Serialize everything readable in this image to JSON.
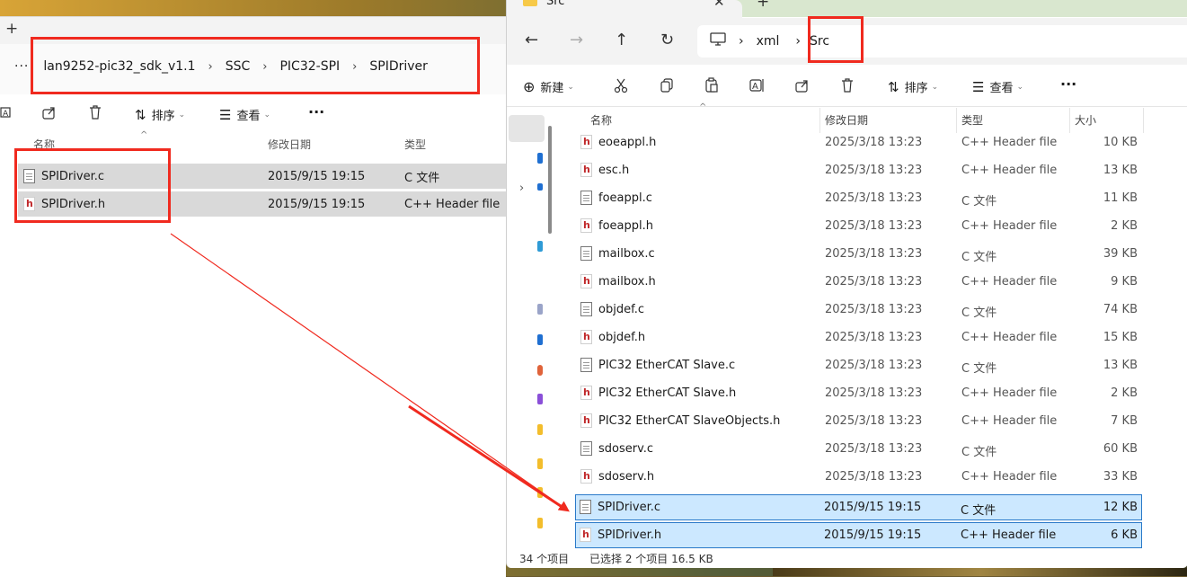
{
  "left_window": {
    "breadcrumb": [
      "lan9252-pic32_sdk_v1.1",
      "SSC",
      "PIC32-SPI",
      "SPIDriver"
    ],
    "more": "···",
    "toolbar": {
      "sort": "排序",
      "view": "查看",
      "more": "···"
    },
    "columns": {
      "name": "名称",
      "date": "修改日期",
      "type": "类型"
    },
    "files": [
      {
        "name": "SPIDriver.c",
        "date": "2015/9/15 19:15",
        "type": "C 文件",
        "icon": "c-file-icon"
      },
      {
        "name": "SPIDriver.h",
        "date": "2015/9/15 19:15",
        "type": "C++ Header file",
        "icon": "h-file-icon"
      }
    ]
  },
  "right_window": {
    "tab_title": "Src",
    "breadcrumb": [
      "xml",
      "Src"
    ],
    "toolbar": {
      "new": "新建",
      "sort": "排序",
      "view": "查看",
      "more": "···"
    },
    "columns": {
      "name": "名称",
      "date": "修改日期",
      "type": "类型",
      "size": "大小"
    },
    "files": [
      {
        "name": "eoeappl.h",
        "date": "2025/3/18 13:23",
        "type": "C++ Header file",
        "size": "10 KB",
        "icon": "h-file-icon"
      },
      {
        "name": "esc.h",
        "date": "2025/3/18 13:23",
        "type": "C++ Header file",
        "size": "13 KB",
        "icon": "h-file-icon"
      },
      {
        "name": "foeappl.c",
        "date": "2025/3/18 13:23",
        "type": "C 文件",
        "size": "11 KB",
        "icon": "c-file-icon"
      },
      {
        "name": "foeappl.h",
        "date": "2025/3/18 13:23",
        "type": "C++ Header file",
        "size": "2 KB",
        "icon": "h-file-icon"
      },
      {
        "name": "mailbox.c",
        "date": "2025/3/18 13:23",
        "type": "C 文件",
        "size": "39 KB",
        "icon": "c-file-icon"
      },
      {
        "name": "mailbox.h",
        "date": "2025/3/18 13:23",
        "type": "C++ Header file",
        "size": "9 KB",
        "icon": "h-file-icon"
      },
      {
        "name": "objdef.c",
        "date": "2025/3/18 13:23",
        "type": "C 文件",
        "size": "74 KB",
        "icon": "c-file-icon"
      },
      {
        "name": "objdef.h",
        "date": "2025/3/18 13:23",
        "type": "C++ Header file",
        "size": "15 KB",
        "icon": "h-file-icon"
      },
      {
        "name": "PIC32 EtherCAT Slave.c",
        "date": "2025/3/18 13:23",
        "type": "C 文件",
        "size": "13 KB",
        "icon": "c-file-icon"
      },
      {
        "name": "PIC32 EtherCAT Slave.h",
        "date": "2025/3/18 13:23",
        "type": "C++ Header file",
        "size": "2 KB",
        "icon": "h-file-icon"
      },
      {
        "name": "PIC32 EtherCAT SlaveObjects.h",
        "date": "2025/3/18 13:23",
        "type": "C++ Header file",
        "size": "7 KB",
        "icon": "h-file-icon"
      },
      {
        "name": "sdoserv.c",
        "date": "2025/3/18 13:23",
        "type": "C 文件",
        "size": "60 KB",
        "icon": "c-file-icon"
      },
      {
        "name": "sdoserv.h",
        "date": "2025/3/18 13:23",
        "type": "C++ Header file",
        "size": "33 KB",
        "icon": "h-file-icon"
      },
      {
        "name": "SPIDriver.c",
        "date": "2015/9/15 19:15",
        "type": "C 文件",
        "size": "12 KB",
        "icon": "c-file-icon",
        "selected": true
      },
      {
        "name": "SPIDriver.h",
        "date": "2015/9/15 19:15",
        "type": "C++ Header file",
        "size": "6 KB",
        "icon": "h-file-icon",
        "selected": true
      }
    ],
    "status": {
      "count": "34 个项目",
      "selected": "已选择 2 个项目  16.5 KB"
    }
  },
  "annotation_color": "#f02a1f"
}
